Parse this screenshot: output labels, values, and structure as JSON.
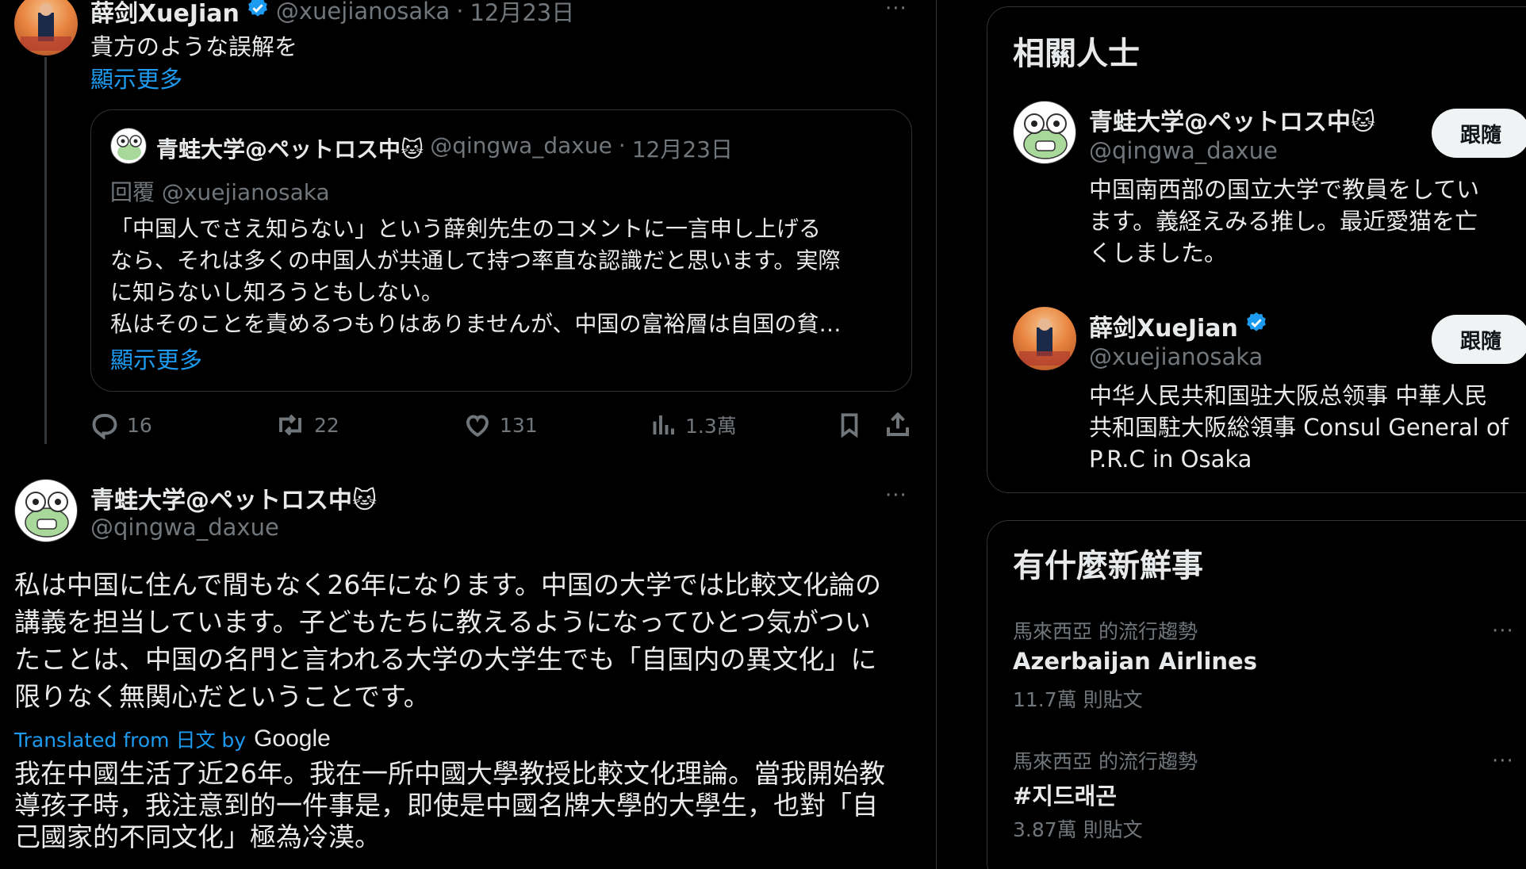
{
  "tweet_top": {
    "display_name": "薛剑XueJian",
    "handle": "@xuejianosaka",
    "separator": "·",
    "date": "12月23日",
    "text": "貴方のような誤解を",
    "show_more": "顯示更多",
    "quote": {
      "display_name": "青蛙大学@ペットロス中🐱",
      "handle": "@qingwa_daxue",
      "separator": "·",
      "date": "12月23日",
      "reply_to": "回覆 @xuejianosaka",
      "lines": [
        "「中国人でさえ知らない」という薛剣先生のコメントに一言申し上げる",
        "なら、それは多くの中国人が共通して持つ率直な認識だと思います。実際",
        "に知らないし知ろうともしない。",
        "私はそのことを責めるつもりはありませんが、中国の富裕層は自国の貧…"
      ],
      "show_more": "顯示更多"
    },
    "actions": {
      "replies": "16",
      "retweets": "22",
      "likes": "131",
      "views": "1.3萬"
    }
  },
  "tweet_main": {
    "display_name": "青蛙大学@ペットロス中🐱",
    "handle": "@qingwa_daxue",
    "lines": [
      "私は中国に住んで間もなく26年になります。中国の大学では比較文化論の",
      "講義を担当しています。子どもたちに教えるようになってひとつ気がつい",
      "たことは、中国の名門と言われる大学の大学生でも「自国内の異文化」に",
      "限りなく無関心だということです。"
    ],
    "translated_from": "Translated from 日文 by",
    "google": "Google",
    "translation_lines": [
      "我在中國生活了近26年。我在一所中國大學教授比較文化理論。當我開始教",
      "導孩子時，我注意到的一件事是，即使是中國名牌大學的大學生，也對「自",
      "己國家的不同文化」極為冷漠。"
    ]
  },
  "related": {
    "title": "相關人士",
    "people": [
      {
        "display_name": "青蛙大学@ペットロス中🐱",
        "handle": "@qingwa_daxue",
        "follow": "跟隨",
        "bio_lines": [
          "中国南西部の国立大学で教員をしてい",
          "ます。義経えみる推し。最近愛猫を亡",
          "くしました。"
        ]
      },
      {
        "display_name": "薛剑XueJian",
        "handle": "@xuejianosaka",
        "follow": "跟隨",
        "bio_lines": [
          "中华人民共和国驻大阪总领事 中華人民",
          "共和国駐大阪総領事 Consul General of",
          "P.R.C in Osaka"
        ]
      }
    ]
  },
  "trending": {
    "title": "有什麼新鮮事",
    "items": [
      {
        "meta": "馬來西亞 的流行趨勢",
        "name": "Azerbaijan Airlines",
        "count": "11.7萬 則貼文"
      },
      {
        "meta": "馬來西亞 的流行趨勢",
        "name": "#지드래곤",
        "count": "3.87萬 則貼文"
      }
    ]
  },
  "colors": {
    "accent": "#1d9bf0",
    "verified": "#1d9bf0",
    "muted": "#71767b",
    "border": "#2f3336"
  },
  "icons": [
    "reply-icon",
    "retweet-icon",
    "like-icon",
    "views-icon",
    "bookmark-icon",
    "share-icon",
    "verified-icon",
    "more-icon"
  ]
}
